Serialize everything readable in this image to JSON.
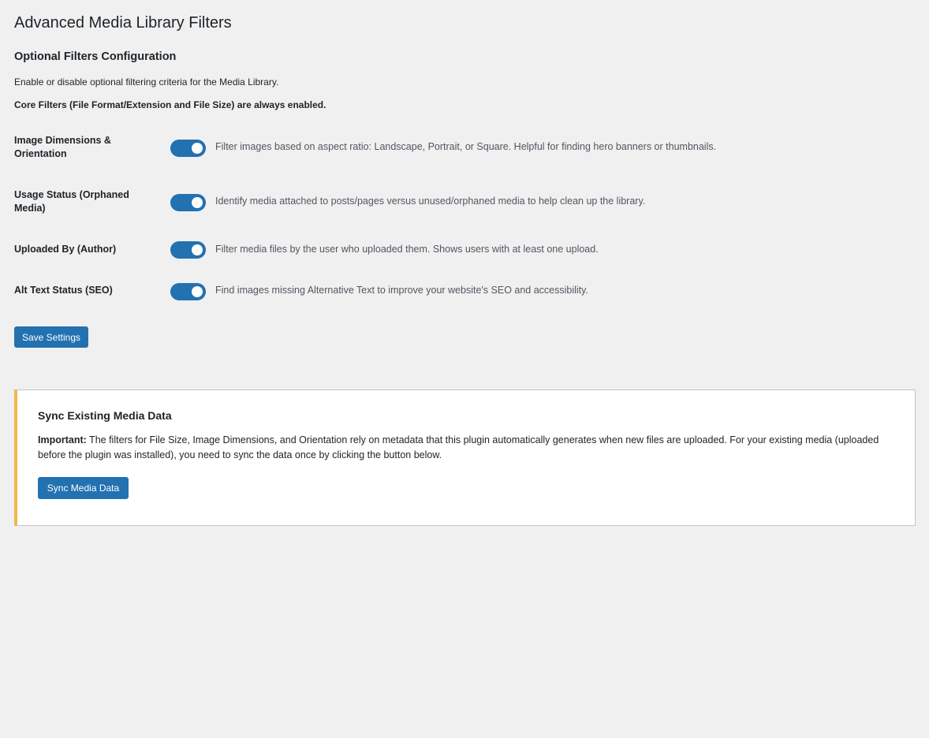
{
  "page": {
    "title": "Advanced Media Library Filters"
  },
  "settings": {
    "section_title": "Optional Filters Configuration",
    "intro": "Enable or disable optional filtering criteria for the Media Library.",
    "core_note": "Core Filters (File Format/Extension and File Size) are always enabled.",
    "filters": [
      {
        "label": "Image Dimensions & Orientation",
        "enabled": true,
        "description": "Filter images based on aspect ratio: Landscape, Portrait, or Square. Helpful for finding hero banners or thumbnails."
      },
      {
        "label": "Usage Status (Orphaned Media)",
        "enabled": true,
        "description": "Identify media attached to posts/pages versus unused/orphaned media to help clean up the library."
      },
      {
        "label": "Uploaded By (Author)",
        "enabled": true,
        "description": "Filter media files by the user who uploaded them. Shows users with at least one upload."
      },
      {
        "label": "Alt Text Status (SEO)",
        "enabled": true,
        "description": "Find images missing Alternative Text to improve your website's SEO and accessibility."
      }
    ],
    "save_label": "Save Settings"
  },
  "sync": {
    "title": "Sync Existing Media Data",
    "important_label": "Important:",
    "text": " The filters for File Size, Image Dimensions, and Orientation rely on metadata that this plugin automatically generates when new files are uploaded. For your existing media (uploaded before the plugin was installed), you need to sync the data once by clicking the button below.",
    "button_label": "Sync Media Data"
  },
  "colors": {
    "background": "#f0f0f1",
    "primary": "#2271b1",
    "notice_accent": "#f0b849",
    "text": "#1d2327",
    "muted_text": "#50575e"
  }
}
